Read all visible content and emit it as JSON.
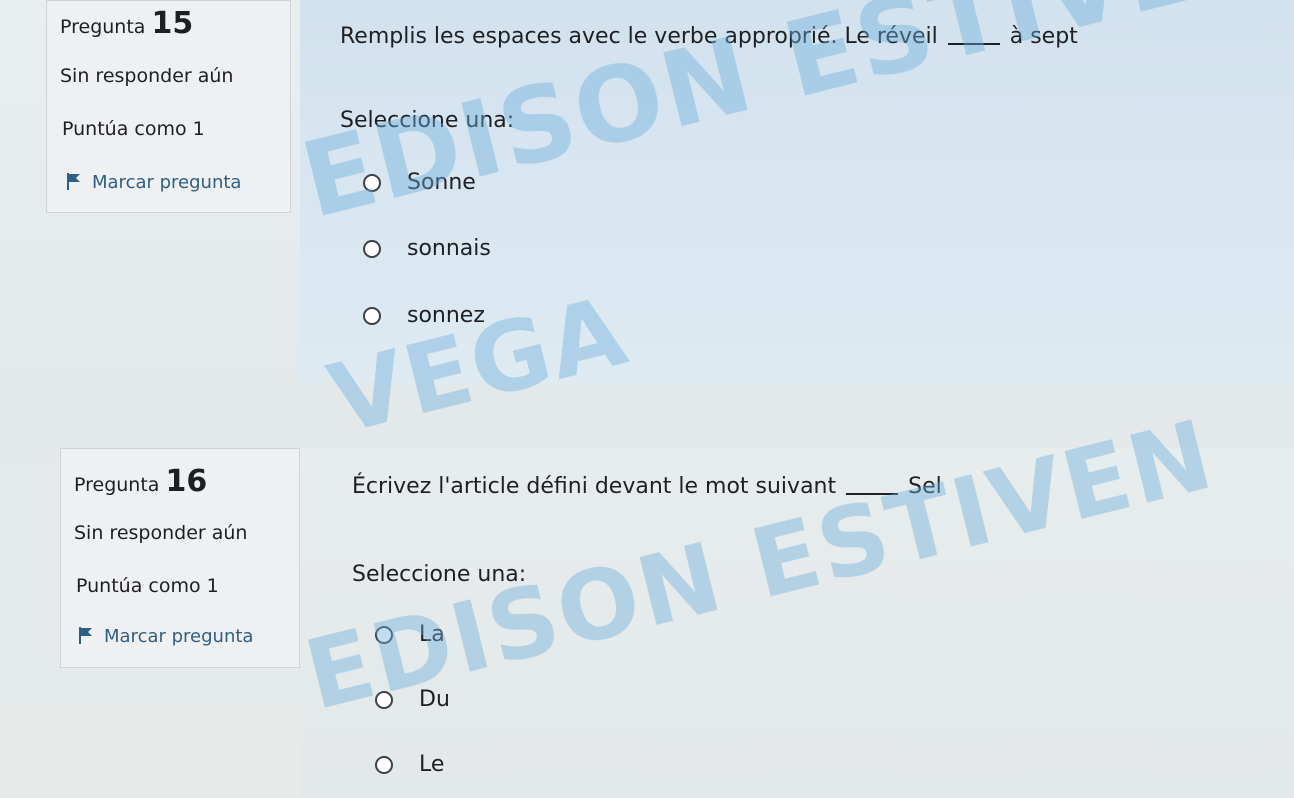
{
  "questions": [
    {
      "label": "Pregunta",
      "number": "15",
      "status": "Sin responder aún",
      "points": "Puntúa como 1",
      "flag_label": "Marcar pregunta",
      "text_before": "Remplis les espaces avec le verbe approprié. Le réveil",
      "text_after": "à sept",
      "prompt": "Seleccione una:",
      "options": [
        "Sonne",
        "sonnais",
        "sonnez"
      ]
    },
    {
      "label": "Pregunta",
      "number": "16",
      "status": "Sin responder aún",
      "points": "Puntúa como 1",
      "flag_label": "Marcar pregunta",
      "text_before": "Écrivez l'article défini devant le mot suivant",
      "text_after": "Sel",
      "prompt": "Seleccione una:",
      "options": [
        "La",
        "Du",
        "Le"
      ]
    }
  ],
  "watermarks": [
    "EDISON ESTIVEN",
    "VEGA",
    "EDISON ESTIVEN"
  ],
  "colors": {
    "flag_link": "#2f5f86",
    "watermark": "#6eafdc"
  }
}
